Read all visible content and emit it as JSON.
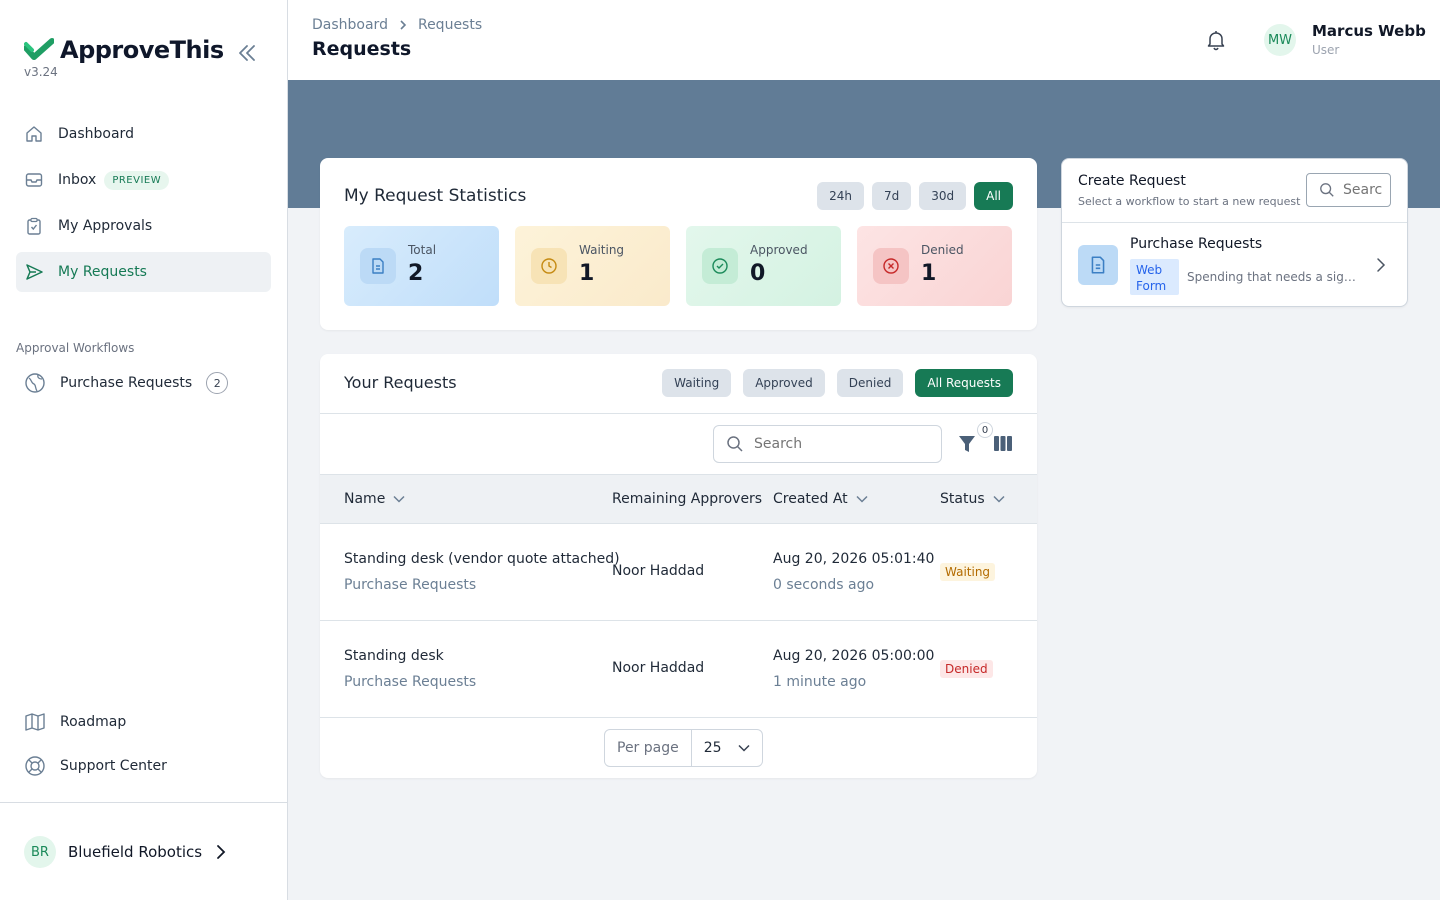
{
  "app": {
    "name": "ApproveThis",
    "version": "v3.24"
  },
  "sidebar": {
    "items": [
      {
        "label": "Dashboard",
        "icon": "home-icon"
      },
      {
        "label": "Inbox",
        "icon": "inbox-icon",
        "badge": "PREVIEW"
      },
      {
        "label": "My Approvals",
        "icon": "clipboard-icon"
      },
      {
        "label": "My Requests",
        "icon": "send-icon",
        "active": true
      }
    ],
    "section_label": "Approval Workflows",
    "workflows": [
      {
        "label": "Purchase Requests",
        "count": "2",
        "icon": "globe-icon"
      }
    ],
    "bottom": [
      {
        "label": "Roadmap",
        "icon": "map-icon"
      },
      {
        "label": "Support Center",
        "icon": "lifebuoy-icon"
      }
    ],
    "org": {
      "initials": "BR",
      "name": "Bluefield Robotics"
    }
  },
  "header": {
    "breadcrumb": [
      "Dashboard",
      "Requests"
    ],
    "title": "Requests",
    "user": {
      "initials": "MW",
      "name": "Marcus Webb",
      "role": "User"
    }
  },
  "stats": {
    "title": "My Request Statistics",
    "ranges": [
      "24h",
      "7d",
      "30d",
      "All"
    ],
    "active_range": "All",
    "tiles": [
      {
        "label": "Total",
        "value": "2"
      },
      {
        "label": "Waiting",
        "value": "1"
      },
      {
        "label": "Approved",
        "value": "0"
      },
      {
        "label": "Denied",
        "value": "1"
      }
    ]
  },
  "requests": {
    "title": "Your Requests",
    "filters": [
      "Waiting",
      "Approved",
      "Denied",
      "All Requests"
    ],
    "active_filter": "All Requests",
    "search_placeholder": "Search",
    "filter_count": "0",
    "columns": [
      "Name",
      "Remaining Approvers",
      "Created At",
      "Status"
    ],
    "rows": [
      {
        "name": "Standing desk (vendor quote attached)",
        "workflow": "Purchase Requests",
        "approvers": "Noor Haddad",
        "created": "Aug 20, 2026 05:01:40",
        "relative": "0 seconds ago",
        "status": "Waiting"
      },
      {
        "name": "Standing desk",
        "workflow": "Purchase Requests",
        "approvers": "Noor Haddad",
        "created": "Aug 20, 2026 05:00:00",
        "relative": "1 minute ago",
        "status": "Denied"
      }
    ],
    "per_page_label": "Per page",
    "per_page": "25"
  },
  "create": {
    "title": "Create Request",
    "subtitle": "Select a workflow to start a new request",
    "search_placeholder": "Search",
    "workflow": {
      "name": "Purchase Requests",
      "tag": "Web Form",
      "description": "Spending that needs a sign-off before it happens"
    }
  },
  "colors": {
    "accent": "#177a55",
    "banner": "#617c96"
  }
}
